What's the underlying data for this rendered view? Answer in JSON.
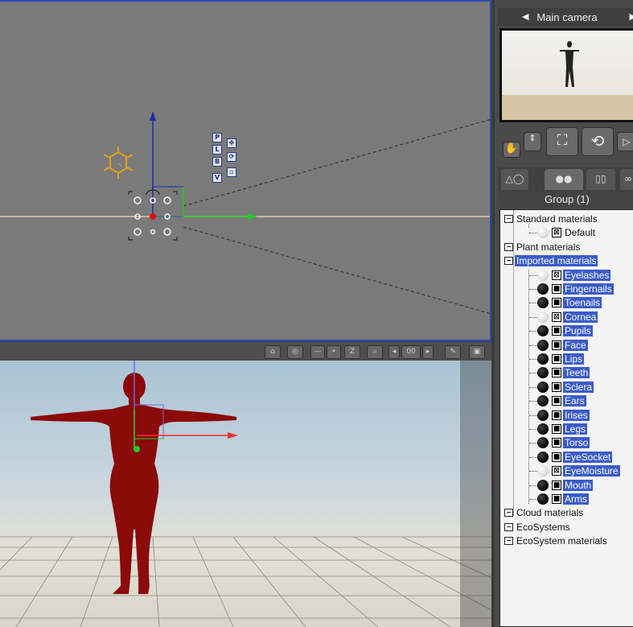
{
  "camera": {
    "title": "Main camera",
    "prev_icon": "◀",
    "next_icon": "▶"
  },
  "gizmo_buttons": [
    "P",
    "L",
    "B",
    "V"
  ],
  "toolbar": {
    "z_label": "Z",
    "frame_label": "00"
  },
  "group_label": "Group (1)",
  "tree": {
    "categories": [
      {
        "label": "Standard materials",
        "selected": false
      },
      {
        "label": "Plant materials",
        "selected": false
      },
      {
        "label": "Imported materials",
        "selected": true
      },
      {
        "label": "Cloud materials",
        "selected": false
      },
      {
        "label": "EcoSystems",
        "selected": false
      },
      {
        "label": "EcoSystem materials",
        "selected": false
      }
    ],
    "standard_items": [
      {
        "label": "Default",
        "swatch": "white",
        "selected": false
      }
    ],
    "imported_items": [
      {
        "label": "Eyelashes",
        "swatch": "white"
      },
      {
        "label": "Fingernails",
        "swatch": "black"
      },
      {
        "label": "Toenails",
        "swatch": "black"
      },
      {
        "label": "Cornea",
        "swatch": "white"
      },
      {
        "label": "Pupils",
        "swatch": "black"
      },
      {
        "label": "Face",
        "swatch": "black"
      },
      {
        "label": "Lips",
        "swatch": "black"
      },
      {
        "label": "Teeth",
        "swatch": "black"
      },
      {
        "label": "Sclera",
        "swatch": "black"
      },
      {
        "label": "Ears",
        "swatch": "black"
      },
      {
        "label": "Irises",
        "swatch": "black"
      },
      {
        "label": "Legs",
        "swatch": "black"
      },
      {
        "label": "Torso",
        "swatch": "black"
      },
      {
        "label": "EyeSocket",
        "swatch": "black"
      },
      {
        "label": "EyeMoisture",
        "swatch": "white"
      },
      {
        "label": "Mouth",
        "swatch": "black"
      },
      {
        "label": "Arms",
        "swatch": "black"
      }
    ]
  },
  "colors": {
    "selection": "#3a5cc8",
    "figure": "#8b0a0a",
    "viewport_border": "#2a4bb8",
    "axis_x": "#22cc22",
    "axis_y": "#1a2aa8",
    "light": "#e0a020"
  }
}
